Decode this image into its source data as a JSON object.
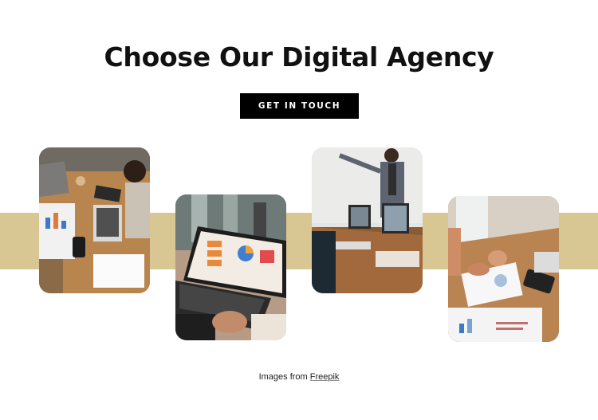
{
  "heading": "Choose Our Digital Agency",
  "cta": {
    "label": "GET IN TOUCH"
  },
  "colors": {
    "band": "#d8c792",
    "button": "#000000"
  },
  "gallery": [
    {
      "name": "team-meeting-photo"
    },
    {
      "name": "laptop-dashboard-photo"
    },
    {
      "name": "presentation-photo"
    },
    {
      "name": "charts-review-photo"
    }
  ],
  "credit": {
    "prefix": "Images from ",
    "link": "Freepik"
  }
}
